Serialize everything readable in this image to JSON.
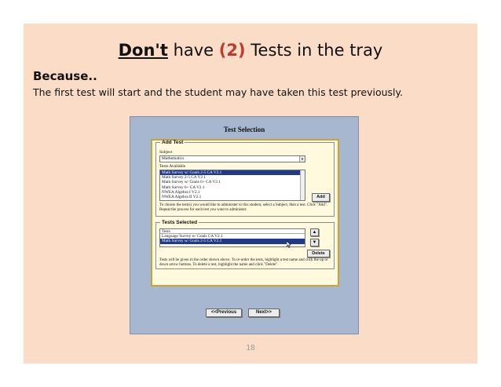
{
  "slide": {
    "title_underlined": "Don't",
    "title_mid": " have ",
    "title_number": "(2)",
    "title_end": " Tests in the tray",
    "because": "Because..",
    "reason": "The first test will start and the student may have taken this test previously.",
    "page_number": "18"
  },
  "screen": {
    "title": "Test Selection",
    "add_test": {
      "legend": "Add Test",
      "subject_label": "Subject",
      "subject_value": "Mathematics",
      "available_label": "Tests Available",
      "available_items": [
        "Math Survey w/ Goals 2-5 CA V2.1",
        "Math Survey 2-5 CA V2.1",
        "Math Survey w/ Goals 6+ CA V2.1",
        "Math Survey 6+ CA V2.1",
        "NWEA Algebra I V2.1",
        "NWEA Algebra II V2.1"
      ],
      "add_label": "Add",
      "help": "To choose the test(s) you would like to administer to this student, select a Subject, then a test. Click \"Add\". Repeat the process for each test you want to administer."
    },
    "tests_selected": {
      "legend": "Tests Selected",
      "header": "Tests",
      "items": [
        "Language Survey w/ Goals CA V2.1",
        "Math Survey w/ Goals 2-5 CA V2.1"
      ],
      "up_glyph": "▲",
      "down_glyph": "▼",
      "delete_label": "Delete",
      "help": "Tests will be given in the order shown above. To re-order the tests, highlight a test name and click the up or down arrow buttons. To delete a test, highlight the name and click \"Delete\"."
    },
    "previous_label": "<<Previous",
    "next_label": "Next>>"
  },
  "icons": {
    "dropdown": "chevron-down-icon",
    "up": "arrow-up-icon",
    "down": "arrow-down-icon",
    "cursor": "mouse-cursor-icon"
  },
  "colors": {
    "slide_bg": "#fbdcc6",
    "screen_bg": "#a7b7cf",
    "panel_bg": "#fff9de",
    "panel_border": "#c7a33a",
    "selection": "#1d3a8e",
    "title_accent": "#c0392b"
  }
}
